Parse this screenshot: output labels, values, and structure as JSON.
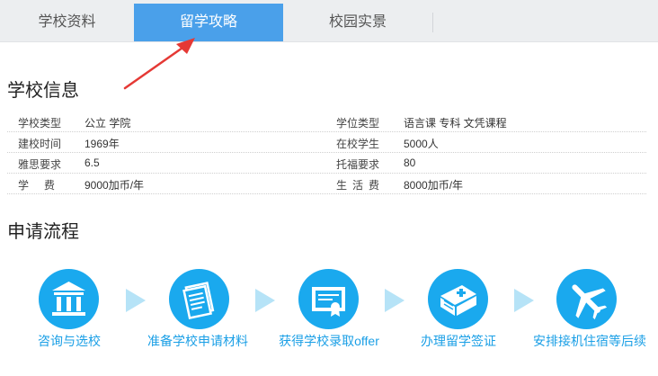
{
  "tabs": [
    {
      "label": "学校资料"
    },
    {
      "label": "留学攻略",
      "active": true
    },
    {
      "label": "校园实景"
    }
  ],
  "colors": {
    "accent": "#4aa0ea",
    "step": "#1aa9ee",
    "arrow": "#e53935"
  },
  "school_info": {
    "heading": "学校信息",
    "rows": [
      {
        "k1": "学校类型",
        "v1": "公立 学院",
        "k2": "学位类型",
        "v2": "语言课 专科 文凭课程"
      },
      {
        "k1": "建校时间",
        "v1": "1969年",
        "k2": "在校学生",
        "v2": "5000人"
      },
      {
        "k1": "雅思要求",
        "v1": "6.5",
        "k2": "托福要求",
        "v2": "80"
      },
      {
        "k1": "学费",
        "v1": "9000加币/年",
        "k2": "生活费",
        "v2": "8000加币/年"
      }
    ]
  },
  "process": {
    "heading": "申请流程",
    "steps": [
      {
        "label": "咨询与选校",
        "icon": "institution-icon"
      },
      {
        "label": "准备学校申请材料",
        "icon": "documents-icon"
      },
      {
        "label": "获得学校录取offer",
        "icon": "certificate-icon"
      },
      {
        "label": "办理留学签证",
        "icon": "passport-book-icon"
      },
      {
        "label": "安排接机住宿等后续",
        "icon": "airplane-icon"
      }
    ]
  }
}
